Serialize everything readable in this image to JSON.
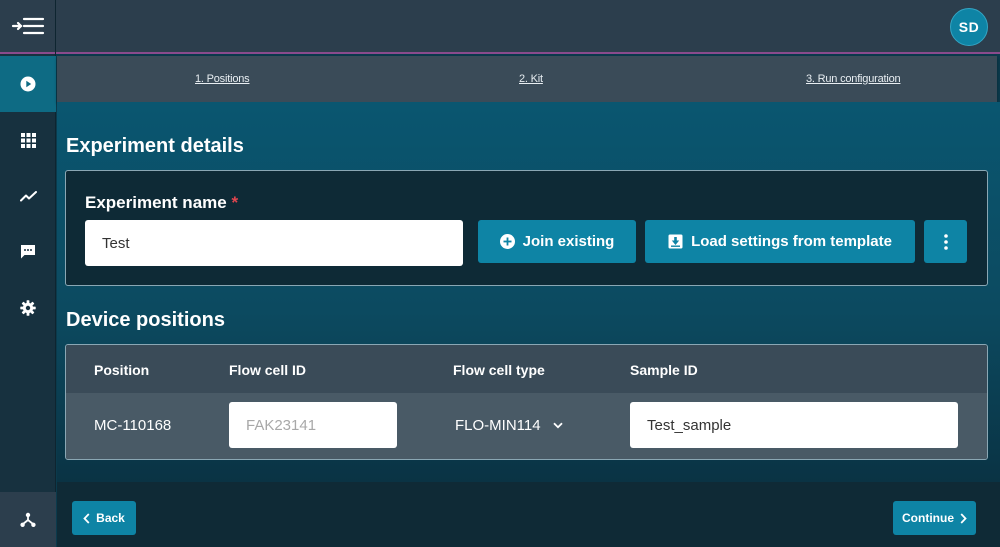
{
  "user": {
    "initials": "SD"
  },
  "stepper": {
    "steps": [
      {
        "label": "1. Positions"
      },
      {
        "label": "2. Kit"
      },
      {
        "label": "3. Run configuration"
      }
    ]
  },
  "experiment": {
    "section_title": "Experiment details",
    "name_label": "Experiment name",
    "required_mark": "*",
    "name_value": "Test",
    "join_existing_label": "Join existing",
    "load_template_label": "Load settings from template"
  },
  "devices": {
    "section_title": "Device positions",
    "columns": [
      "Position",
      "Flow cell ID",
      "Flow cell type",
      "Sample ID"
    ],
    "rows": [
      {
        "position": "MC-110168",
        "flow_cell_id_placeholder": "FAK23141",
        "flow_cell_type": "FLO-MIN114",
        "sample_id": "Test_sample"
      }
    ]
  },
  "footer": {
    "back_label": "Back",
    "continue_label": "Continue"
  },
  "colors": {
    "accent": "#0e84a5",
    "sidebar": "#17313f",
    "topbar": "#2c3e4d",
    "top_border": "#8a4b8c",
    "required": "#e2464f"
  }
}
